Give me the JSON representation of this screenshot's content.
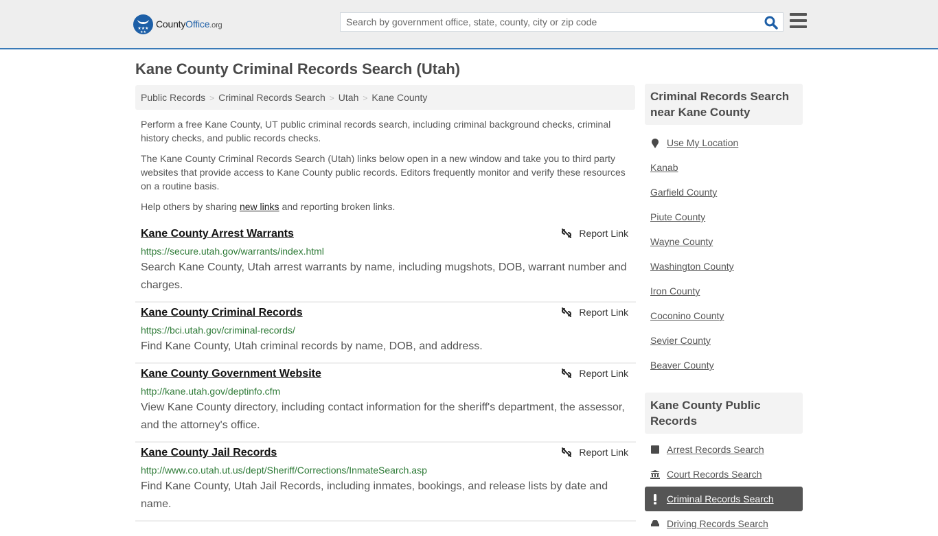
{
  "header": {
    "logo": {
      "county": "County",
      "office": "Office",
      "org": ".org"
    },
    "search": {
      "placeholder": "Search by government office, state, county, city or zip code",
      "value": ""
    },
    "icons": {
      "search": "search-icon",
      "menu": "hamburger-menu-icon"
    }
  },
  "page": {
    "title": "Kane County Criminal Records Search (Utah)",
    "breadcrumb": [
      "Public Records",
      "Criminal Records Search",
      "Utah",
      "Kane County"
    ],
    "intro": {
      "p1": "Perform a free Kane County, UT public criminal records search, including criminal background checks, criminal history checks, and public records checks.",
      "p2": "The Kane County Criminal Records Search (Utah) links below open in a new window and take you to third party websites that provide access to Kane County public records. Editors frequently monitor and verify these resources on a routine basis.",
      "p3_before": "Help others by sharing ",
      "p3_link": "new links",
      "p3_after": " and reporting broken links."
    }
  },
  "results": [
    {
      "title": "Kane County Arrest Warrants",
      "url": "https://secure.utah.gov/warrants/index.html",
      "description": "Search Kane County, Utah arrest warrants by name, including mugshots, DOB, warrant number and charges.",
      "report_label": "Report Link"
    },
    {
      "title": "Kane County Criminal Records",
      "url": "https://bci.utah.gov/criminal-records/",
      "description": "Find Kane County, Utah criminal records by name, DOB, and address.",
      "report_label": "Report Link"
    },
    {
      "title": "Kane County Government Website",
      "url": "http://kane.utah.gov/deptinfo.cfm",
      "description": "View Kane County directory, including contact information for the sheriff's department, the assessor, and the attorney's office.",
      "report_label": "Report Link"
    },
    {
      "title": "Kane County Jail Records",
      "url": "http://www.co.utah.ut.us/dept/Sheriff/Corrections/InmateSearch.asp",
      "description": "Find Kane County, Utah Jail Records, including inmates, bookings, and release lists by date and name.",
      "report_label": "Report Link"
    }
  ],
  "sidebar": {
    "nearby": {
      "heading": "Criminal Records Search near Kane County",
      "use_location": "Use My Location",
      "items": [
        "Kanab",
        "Garfield County",
        "Piute County",
        "Wayne County",
        "Washington County",
        "Iron County",
        "Coconino County",
        "Sevier County",
        "Beaver County"
      ]
    },
    "public_records": {
      "heading": "Kane County Public Records",
      "items": [
        {
          "label": "Arrest Records Search",
          "icon": "square-icon",
          "active": false
        },
        {
          "label": "Court Records Search",
          "icon": "courthouse-icon",
          "active": false
        },
        {
          "label": "Criminal Records Search",
          "icon": "exclamation-icon",
          "active": true
        },
        {
          "label": "Driving Records Search",
          "icon": "car-icon",
          "active": false
        }
      ]
    }
  },
  "colors": {
    "accent": "#3a7ab7",
    "brand": "#1d5fa7",
    "url_green": "#2d7a36",
    "active_bg": "#555555"
  }
}
